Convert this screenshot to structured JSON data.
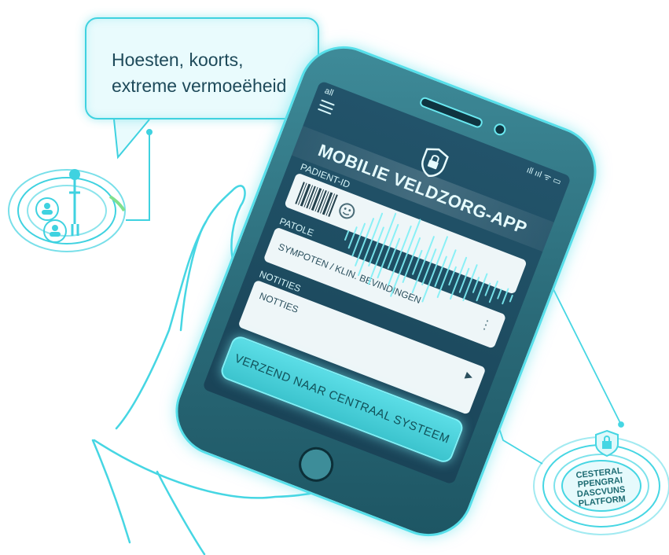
{
  "speech_bubble": {
    "line1": "Hoesten, koorts,",
    "line2": "extreme vermoeëheid"
  },
  "phone": {
    "status_bar": {
      "left": "all",
      "right": "ıll ııl ᯤ ▭"
    },
    "app_title": "MOBILIE VELDZORG-APP",
    "sections": {
      "patient_label": "PADIENT-ID",
      "symptoms_label": "PATOLE",
      "symptoms_value": "SYMPOTEN / KLIN. BEVINDINGEN",
      "notes_label": "NOTITIES",
      "notes_value": "NOTTIES"
    },
    "send_button_label": "VERZEND NAAR CENTRAAL SYSTEEM"
  },
  "platform_badge": {
    "line1": "CESTERAL",
    "line2": "PPENGRAI",
    "line3": "DASCVUNS",
    "line4": "PLATFORM"
  },
  "colors": {
    "accent": "#3fd2e0",
    "phone_body": "#2a6a78",
    "screen": "#1e4d62",
    "button": "#4fd3dc"
  }
}
